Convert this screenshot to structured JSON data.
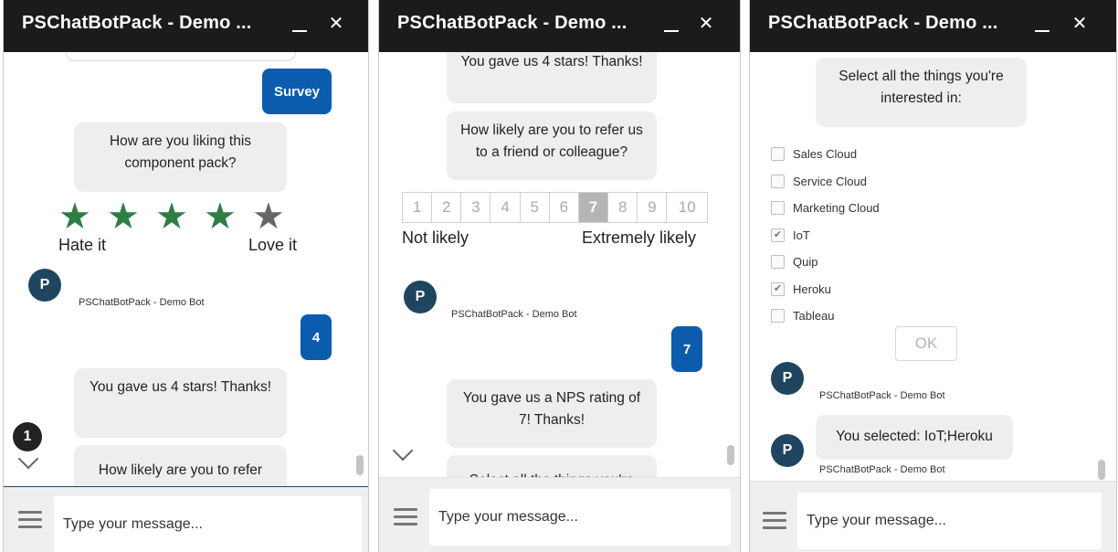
{
  "colors": {
    "header_bg": "#1b1b1b",
    "user_bubble": "#0b5cad",
    "bot_bubble": "#eeeeee",
    "avatar": "#1f4560",
    "star_filled": "#2e7d45",
    "star_empty": "#666666"
  },
  "title": "PSChatBotPack - Demo ...",
  "bot_name": "PSChatBotPack - Demo Bot",
  "avatar_letter": "P",
  "input_placeholder": "Type your message...",
  "icons": {
    "minimize": "minimize-icon",
    "close": "close-icon",
    "menu": "hamburger-menu-icon",
    "chevron": "chevron-down-icon",
    "star": "star-icon"
  },
  "panel1": {
    "survey_label": "Survey",
    "question": "How are you liking this component pack?",
    "stars": {
      "filled": 4,
      "total": 5
    },
    "hate_label": "Hate it",
    "love_label": "Love it",
    "user_reply": "4",
    "bot_reply": "You gave us 4 stars! Thanks!",
    "bot_next": "How likely are you to refer",
    "unread_badge": "1"
  },
  "panel2": {
    "prev_reply": "You gave us 4 stars! Thanks!",
    "question": "How likely are you to refer us to a friend or colleague?",
    "nps_options": [
      "1",
      "2",
      "3",
      "4",
      "5",
      "6",
      "7",
      "8",
      "9",
      "10"
    ],
    "nps_selected": "7",
    "not_likely_label": "Not likely",
    "extremely_likely_label": "Extremely likely",
    "user_reply": "7",
    "bot_reply": "You gave us a NPS rating of 7! Thanks!",
    "bot_next": "Select all the things you're"
  },
  "panel3": {
    "question": "Select all the things you're interested in:",
    "options": [
      {
        "label": "Sales Cloud",
        "checked": false
      },
      {
        "label": "Service Cloud",
        "checked": false
      },
      {
        "label": "Marketing Cloud",
        "checked": false
      },
      {
        "label": "IoT",
        "checked": true
      },
      {
        "label": "Quip",
        "checked": false
      },
      {
        "label": "Heroku",
        "checked": true
      },
      {
        "label": "Tableau",
        "checked": false
      }
    ],
    "ok_label": "OK",
    "selected_message": "You selected:  IoT;Heroku"
  }
}
